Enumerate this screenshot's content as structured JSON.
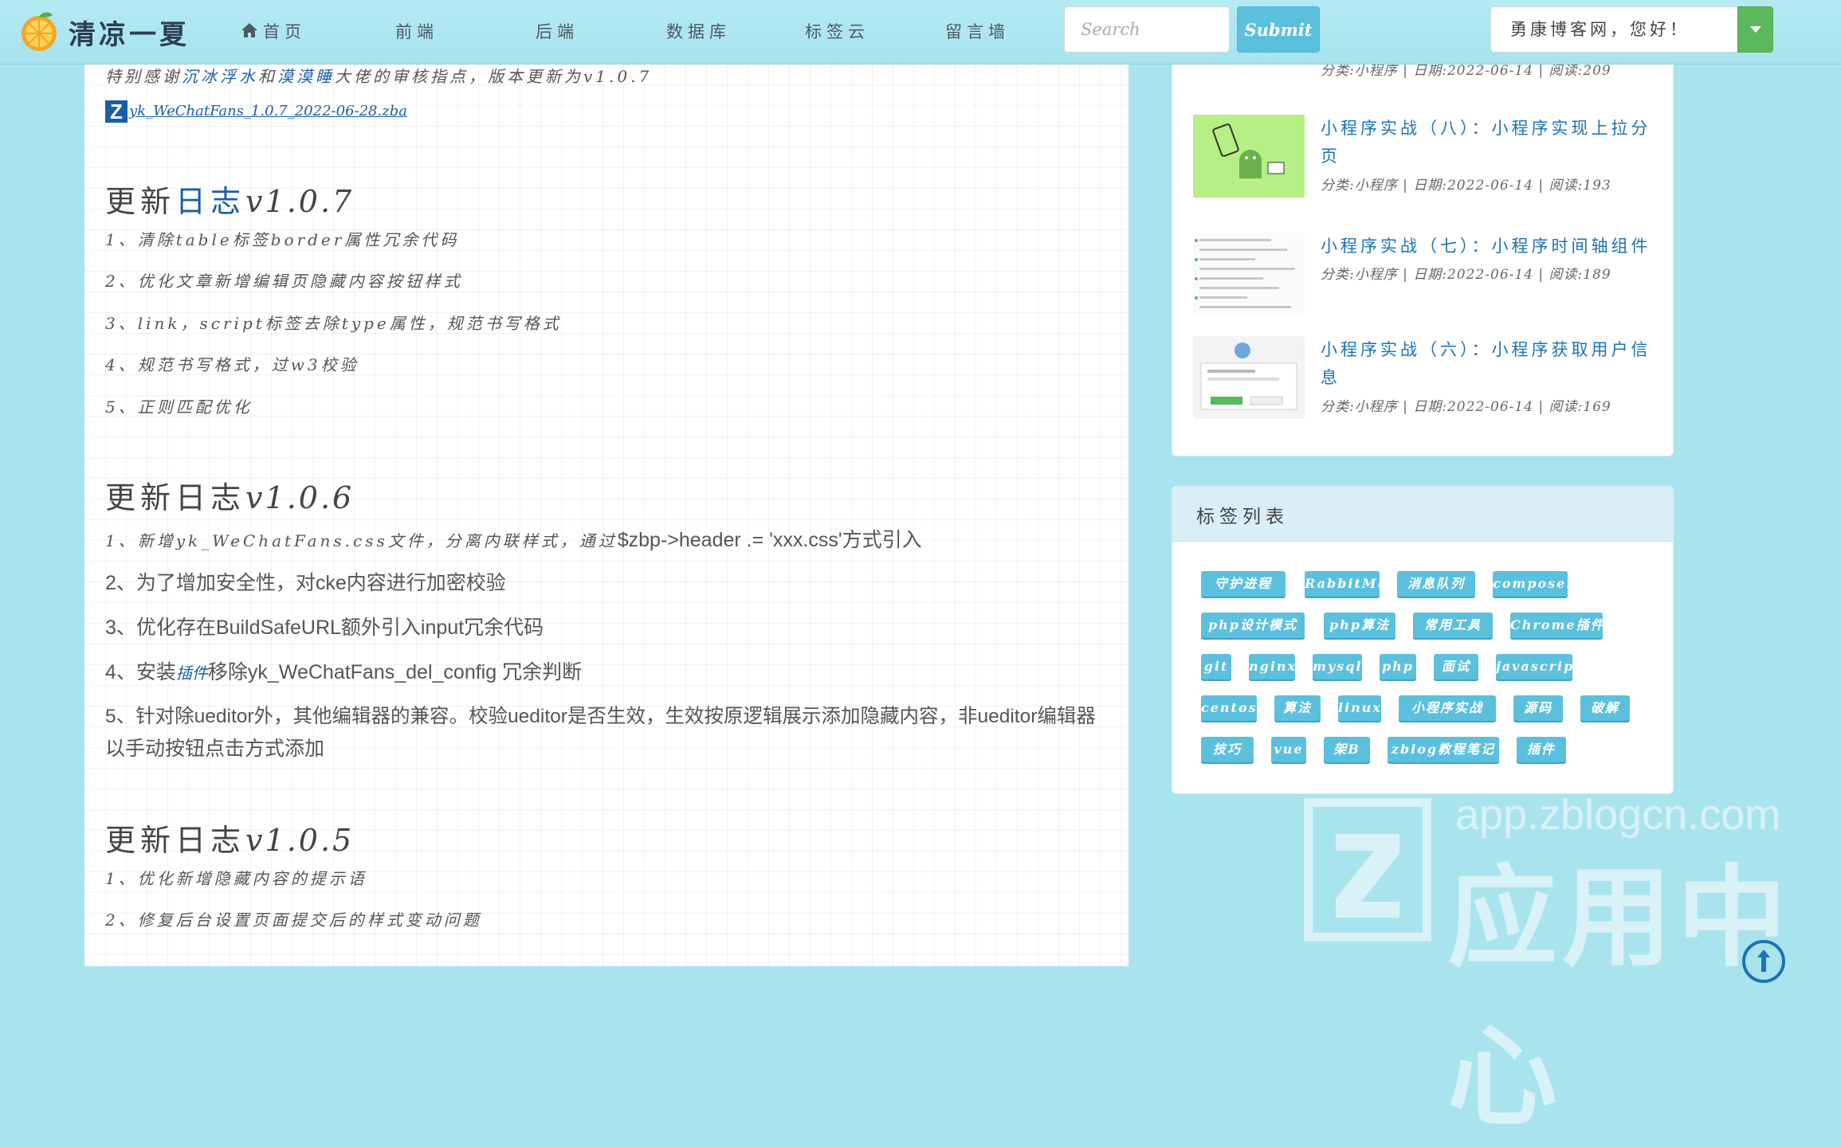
{
  "navbar": {
    "logo_text": "清凉一夏",
    "items": [
      {
        "label": "首页"
      },
      {
        "label": "前端"
      },
      {
        "label": "后端"
      },
      {
        "label": "数据库"
      },
      {
        "label": "标签云"
      },
      {
        "label": "留言墙"
      }
    ],
    "search_placeholder": "Search",
    "submit_label": "Submit",
    "greeting": "勇康博客网，您好！"
  },
  "article": {
    "thanks_line_pre": "特别感谢",
    "thanks_link_1": "沉冰浮水",
    "thanks_mid": "和",
    "thanks_link_2": "漠漠睡",
    "thanks_line_post": "大佬的审核指点，版本更新为v1.0.7",
    "zip_file": "yk_WeChatFans_1.0.7_2022-06-28.zba",
    "logs": [
      {
        "heading_pre": "更新",
        "heading_mid": "日",
        "heading_hl": "志",
        "version": "v1.0.7",
        "items": [
          "1、清除table标签border属性冗余代码",
          "2、优化文章新增编辑页隐藏内容按钮样式",
          "3、link，script标签去除type属性，规范书写格式",
          "4、规范书写格式，过w3校验",
          "5、正则匹配优化"
        ]
      },
      {
        "heading_pre": "更新",
        "heading_mid": "日",
        "heading_hl": "志",
        "version": "v1.0.6",
        "item1_italic": "1、新增yk_WeChatFans.css文件，分离内联样式，通过",
        "item1_sans": "$zbp->header .= 'xxx.css'方式引入",
        "items_sans": [
          "2、为了增加安全性，对cke内容进行加密校验",
          "3、优化存在BuildSafeURL额外引入input冗余代码"
        ],
        "item4_pre": "4、安装",
        "item4_link": "插件",
        "item4_post": "移除yk_WeChatFans_del_config 冗余判断",
        "item5_line1": "5、针对除ueditor外，其他编辑器的兼容。校验ueditor是否生效，生效按原逻辑展示添加隐藏内容，非ueditor编辑器",
        "item5_line2": "以手动按钮点击方式添加"
      },
      {
        "heading_pre": "更新",
        "heading_mid": "日",
        "heading_hl": "志",
        "version": "v1.0.5",
        "items": [
          "1、优化新增隐藏内容的提示语",
          "2、修复后台设置页面提交后的样式变动问题"
        ]
      }
    ]
  },
  "sidebar": {
    "recent_posts": [
      {
        "title": "",
        "meta": "分类:小程序 | 日期:2022-06-14 | 阅读:209"
      },
      {
        "title": "小程序实战（八）：小程序实现上拉分页",
        "meta": "分类:小程序 | 日期:2022-06-14 | 阅读:193"
      },
      {
        "title": "小程序实战（七）：小程序时间轴组件",
        "meta": "分类:小程序 | 日期:2022-06-14 | 阅读:189"
      },
      {
        "title": "小程序实战（六）：小程序获取用户信息",
        "meta": "分类:小程序 | 日期:2022-06-14 | 阅读:169"
      }
    ],
    "tags_title": "标签列表",
    "tags": [
      "守护进程",
      "RabbitMq",
      "消息队列",
      "composer",
      "php设计模式",
      "php算法",
      "常用工具",
      "Chrome插件",
      "git",
      "nginx",
      "mysql",
      "php",
      "面试",
      "javascript",
      "centos",
      "算法",
      "linux",
      "小程序实战",
      "源码",
      "破解",
      "技巧",
      "vue",
      "架B",
      "zblog教程笔记",
      "插件"
    ]
  },
  "watermark": {
    "url": "app.zblogcn.com",
    "text": "应用中心"
  },
  "colors": {
    "accent": "#5bc0de",
    "link": "#1a73b5",
    "background": "#a9e4ee"
  }
}
